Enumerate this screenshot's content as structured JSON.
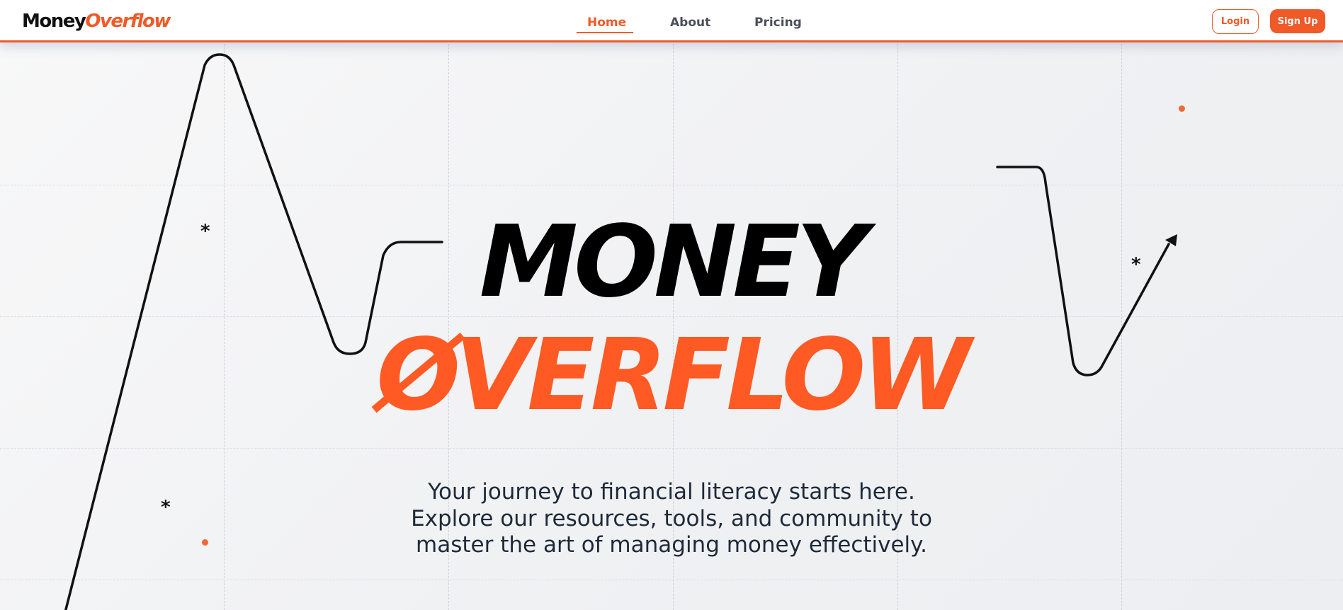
{
  "brand": {
    "logo_part1": "Money",
    "logo_part2": "Overflow",
    "accent_color": "#f05a28",
    "dark_color": "#111111"
  },
  "nav": {
    "items": [
      {
        "label": "Home",
        "active": true
      },
      {
        "label": "About",
        "active": false
      },
      {
        "label": "Pricing",
        "active": false
      }
    ]
  },
  "auth": {
    "login_label": "Login",
    "signup_label": "Sign Up"
  },
  "hero": {
    "title_line1": "MONEY",
    "title_line2": "ØVERFLOW",
    "subtitle_lines": [
      "Your journey to financial literacy starts here.",
      "Explore our resources, tools, and community to",
      "master the art of managing money effectively."
    ]
  },
  "decorations": {
    "asterisk_glyph": "*",
    "icons": [
      "graph-line-left",
      "graph-arrow-right",
      "asterisk-icon",
      "accent-dot"
    ]
  }
}
